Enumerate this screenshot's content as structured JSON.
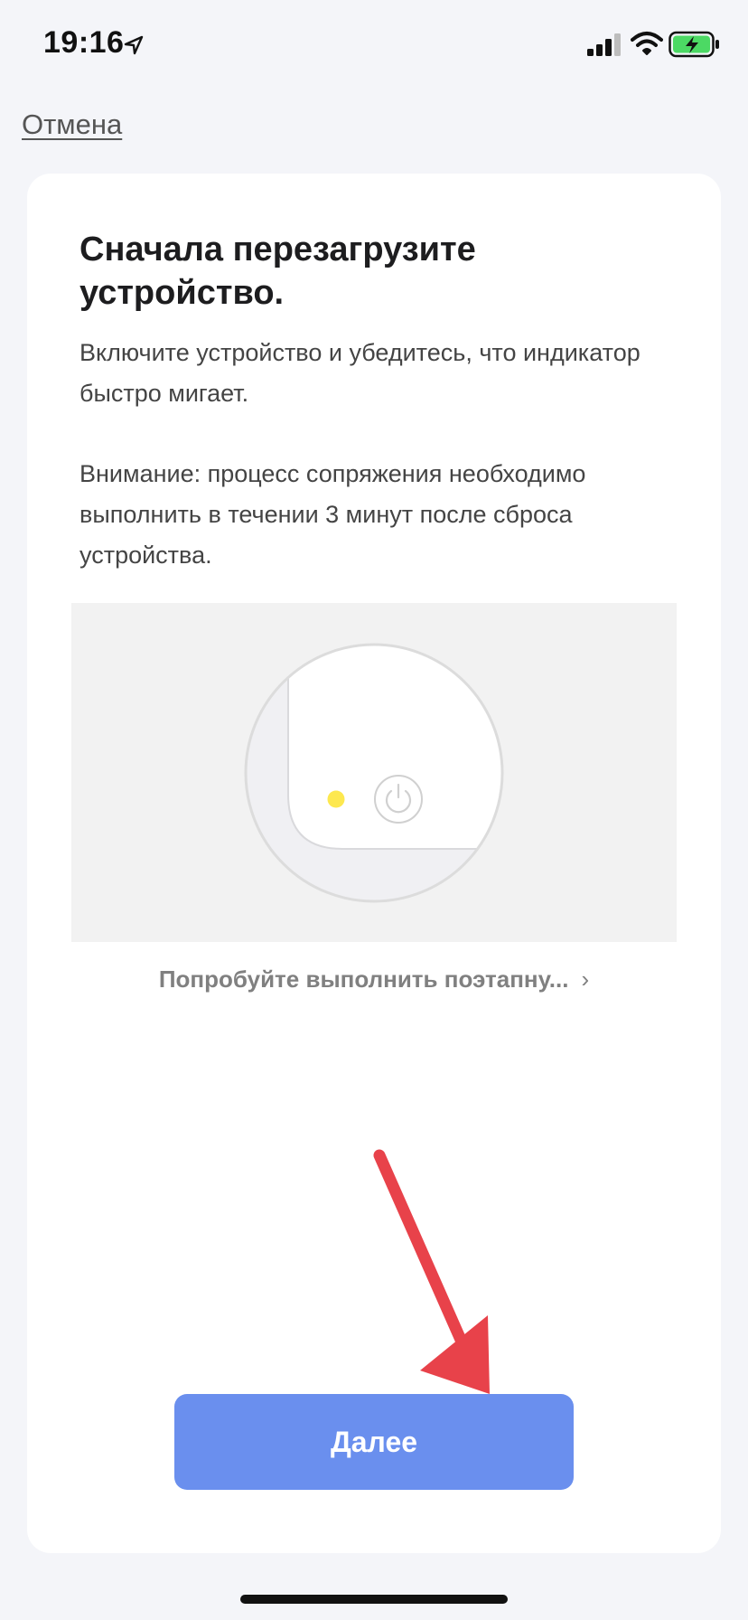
{
  "status_bar": {
    "time": "19:16",
    "icons": [
      "location-arrow-icon",
      "cellular-signal-icon",
      "wifi-icon",
      "battery-charging-icon"
    ],
    "battery_color": "#4cd964"
  },
  "nav": {
    "cancel_label": "Отмена"
  },
  "card": {
    "title": "Сначала перезагрузите устройство.",
    "description": "Включите устройство и убедитесь, что индикатор быстро мигает.",
    "warning": "Внимание: процесс сопряжения необходимо выполнить в течении 3 минут после сброса устройства.",
    "illustration": {
      "indicator_color": "#fde84f",
      "icons": [
        "power-icon"
      ]
    },
    "guide_link_label": "Попробуйте выполнить поэтапну...",
    "guide_link_icon": "chevron-right-icon"
  },
  "actions": {
    "next_label": "Далее",
    "accent_color": "#6a8fee",
    "annotation_arrow_color": "#e8424a"
  }
}
